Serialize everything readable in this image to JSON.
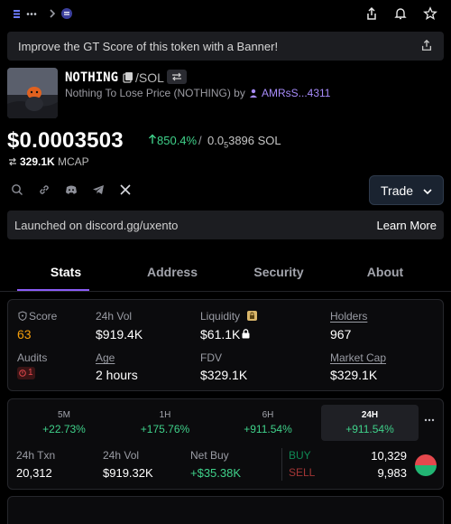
{
  "topbar": {
    "menu_icon": "menu-icon",
    "more_icon": "more-dots-icon",
    "chevron_icon": "chevron-right-icon",
    "share_icon": "share-icon",
    "alert_icon": "bell-icon",
    "favorite_icon": "star-icon"
  },
  "banner": {
    "text": "Improve the GT Score of this token with a Banner!",
    "icon": "share-icon"
  },
  "token": {
    "symbol": "NOTHING",
    "pair": "/SOL",
    "description": "Nothing To Lose Price (NOTHING) by",
    "author": "AMRsS...4311"
  },
  "price": {
    "usd": "$0.0003503",
    "change": "850.4%",
    "separator": "/",
    "sol_prefix": "0.0",
    "sol_zeros": "5",
    "sol_digits": "3896",
    "sol_unit": "SOL",
    "mcap_value": "329.1K",
    "mcap_label": "MCAP"
  },
  "social_icons": [
    "search-icon",
    "link-icon",
    "discord-icon",
    "telegram-icon",
    "x-icon"
  ],
  "trade": {
    "label": "Trade"
  },
  "launch": {
    "text": "Launched on discord.gg/uxento",
    "link": "Learn More"
  },
  "tabs": [
    "Stats",
    "Address",
    "Security",
    "About"
  ],
  "stats": {
    "score_label": "Score",
    "score_value": "63",
    "vol_label": "24h Vol",
    "vol_value": "$919.4K",
    "liquidity_label": "Liquidity",
    "liquidity_value": "$61.1K",
    "holders_label": "Holders",
    "holders_value": "967",
    "audits_label": "Audits",
    "audits_value": "1",
    "age_label": "Age",
    "age_value": "2 hours",
    "fdv_label": "FDV",
    "fdv_value": "$329.1K",
    "mcap_label": "Market Cap",
    "mcap_value": "$329.1K"
  },
  "timeframes": [
    {
      "name": "5M",
      "change": "+22.73%"
    },
    {
      "name": "1H",
      "change": "+175.76%"
    },
    {
      "name": "6H",
      "change": "+911.54%"
    },
    {
      "name": "24H",
      "change": "+911.54%"
    }
  ],
  "txn": {
    "txn_label": "24h Txn",
    "txn_value": "20,312",
    "vol_label": "24h Vol",
    "vol_value": "$919.32K",
    "netbuy_label": "Net Buy",
    "netbuy_value": "+$35.38K",
    "buy_label": "BUY",
    "buy_value": "10,329",
    "sell_label": "SELL",
    "sell_value": "9,983"
  },
  "colors": {
    "positive": "#3fd18a",
    "negative": "#e5484d",
    "accent": "#8b5cf6",
    "score": "#f59e0b"
  }
}
